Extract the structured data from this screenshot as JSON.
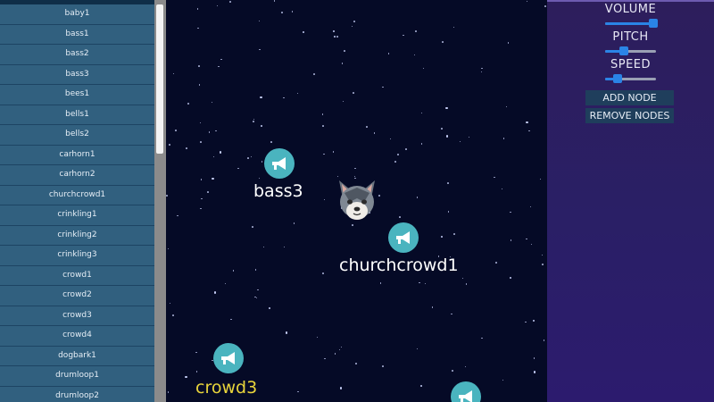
{
  "sounds": [
    "baby1",
    "bass1",
    "bass2",
    "bass3",
    "bees1",
    "bells1",
    "bells2",
    "carhorn1",
    "carhorn2",
    "churchcrowd1",
    "crinkling1",
    "crinkling2",
    "crinkling3",
    "crowd1",
    "crowd2",
    "crowd3",
    "crowd4",
    "dogbark1",
    "drumloop1",
    "drumloop2"
  ],
  "controls": {
    "volume": {
      "label": "VOLUME",
      "value": 0.95
    },
    "pitch": {
      "label": "PITCH",
      "value": 0.37
    },
    "speed": {
      "label": "SPEED",
      "value": 0.25
    }
  },
  "buttons": {
    "add_node": "ADD NODE",
    "remove_nodes": "REMOVE NODES"
  },
  "nodes": [
    {
      "label": "bass3",
      "active": false
    },
    {
      "label": "churchcrowd1",
      "active": false
    },
    {
      "label": "crowd3",
      "active": true
    },
    {
      "label": "",
      "active": false
    }
  ],
  "colors": {
    "node": "#4ab4bf",
    "active_label": "#e9d53b",
    "slider": "#2a84e6"
  },
  "icons": {
    "node": "megaphone-icon",
    "listener": "wolf-icon"
  }
}
